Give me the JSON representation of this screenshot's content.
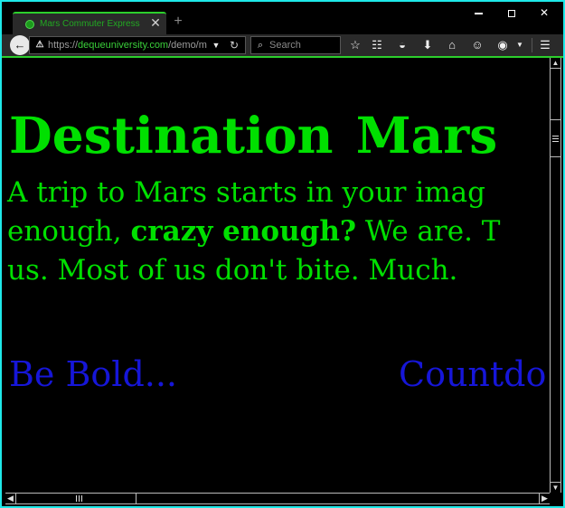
{
  "browser": {
    "tab": {
      "title": "Mars Commuter Express",
      "favicon": "globe-icon",
      "close_glyph": "✕"
    },
    "new_tab_glyph": "+",
    "window_controls": {
      "minimize": "minimize-icon",
      "maximize": "maximize-icon",
      "close": "✕"
    },
    "url": {
      "protocol": "https://",
      "host": "dequeuniversity.com",
      "path": "/demo/m"
    },
    "search": {
      "placeholder": "Search"
    },
    "toolbar_icons": [
      "bookmark-star-icon",
      "reader-view-icon",
      "pocket-icon",
      "download-icon",
      "home-icon",
      "hello-icon",
      "tracking-icon",
      "menu-icon"
    ]
  },
  "page": {
    "heading": "Destination Mars",
    "intro": {
      "part1": "A trip to Mars starts in your imag",
      "part2": "enough, ",
      "bold": "crazy enough?",
      "part3": " We are. T",
      "part4": "us. Most of us don't bite. Much."
    },
    "links": {
      "be_bold": "Be Bold...",
      "countdown": "Countdo"
    }
  },
  "colors": {
    "text": "#00e000",
    "link": "#1616d8",
    "background": "#000000",
    "window_border": "#1ee8e8",
    "tab_accent": "#2ccf2c"
  }
}
